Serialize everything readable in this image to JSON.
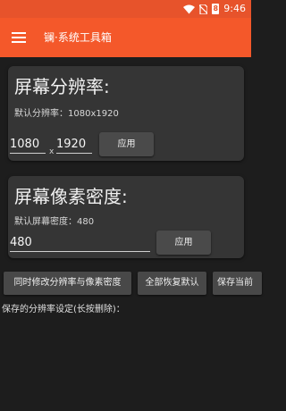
{
  "status": {
    "time": "9:46",
    "battery_label": "8"
  },
  "appbar": {
    "title": "镧·系统工具箱"
  },
  "resolution_card": {
    "title": "屏幕分辨率:",
    "default_text": "默认分辨率：1080x1920",
    "width_value": "1080",
    "times": "x",
    "height_value": "1920",
    "apply_label": "应用"
  },
  "density_card": {
    "title": "屏幕像素密度:",
    "default_text": "默认屏幕密度：480",
    "density_value": "480",
    "apply_label": "应用"
  },
  "actions": {
    "modify_both_label": "同时修改分辨率与像素密度",
    "restore_all_label": "全部恢复默认",
    "save_current_label": "保存当前"
  },
  "saved": {
    "label": "保存的分辨率设定(长按删除)："
  }
}
